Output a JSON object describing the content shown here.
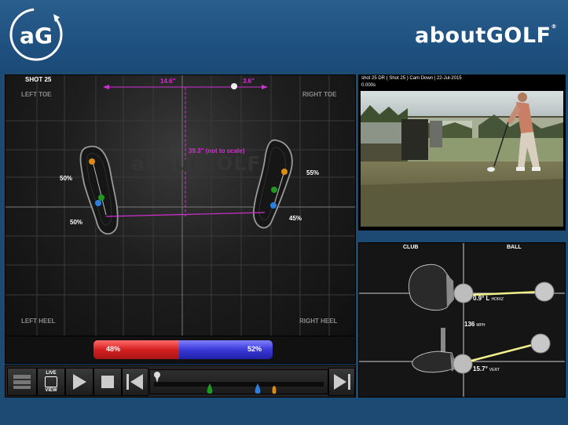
{
  "header": {
    "logo_text": "aG",
    "brand": "aboutGOLF",
    "brand_mark": "®"
  },
  "pressure": {
    "title": "SHOT 25",
    "watermark": "aboutGOLF",
    "corners": {
      "left_toe": "LEFT TOE",
      "right_toe": "RIGHT TOE",
      "left_heel": "LEFT HEEL",
      "right_heel": "RIGHT HEEL"
    },
    "left_foot": {
      "toe_pct": "50%",
      "heel_pct": "50%"
    },
    "right_foot": {
      "toe_pct": "55%",
      "heel_pct": "45%"
    },
    "dims": {
      "left_offset": "14.6\"",
      "right_offset": "3.6\"",
      "depth": "39.3\" (not to scale)"
    }
  },
  "balance": {
    "left_pct": "48%",
    "right_pct": "52%",
    "left_value": 48,
    "right_value": 52
  },
  "controls": {
    "live_label": "LIVE",
    "view_label": "VIEW"
  },
  "video": {
    "caption": "shot 25 DR ( Shot 25 ) Cam Down  |  22-Jul-2015",
    "time": "0.000s"
  },
  "club_ball": {
    "club_label": "CLUB",
    "ball_label": "BALL",
    "horiz_value": "0.9° L",
    "horiz_unit": "HORIZ",
    "speed_value": "136",
    "speed_unit": "MPH",
    "vert_value": "15.7°",
    "vert_unit": "VERT"
  },
  "colors": {
    "magenta": "#d030d0",
    "orange": "#e08a10",
    "green": "#1f9a1f",
    "blue": "#2a7fe0",
    "red": "#d42020",
    "purple_blue": "#3a3ad8"
  }
}
